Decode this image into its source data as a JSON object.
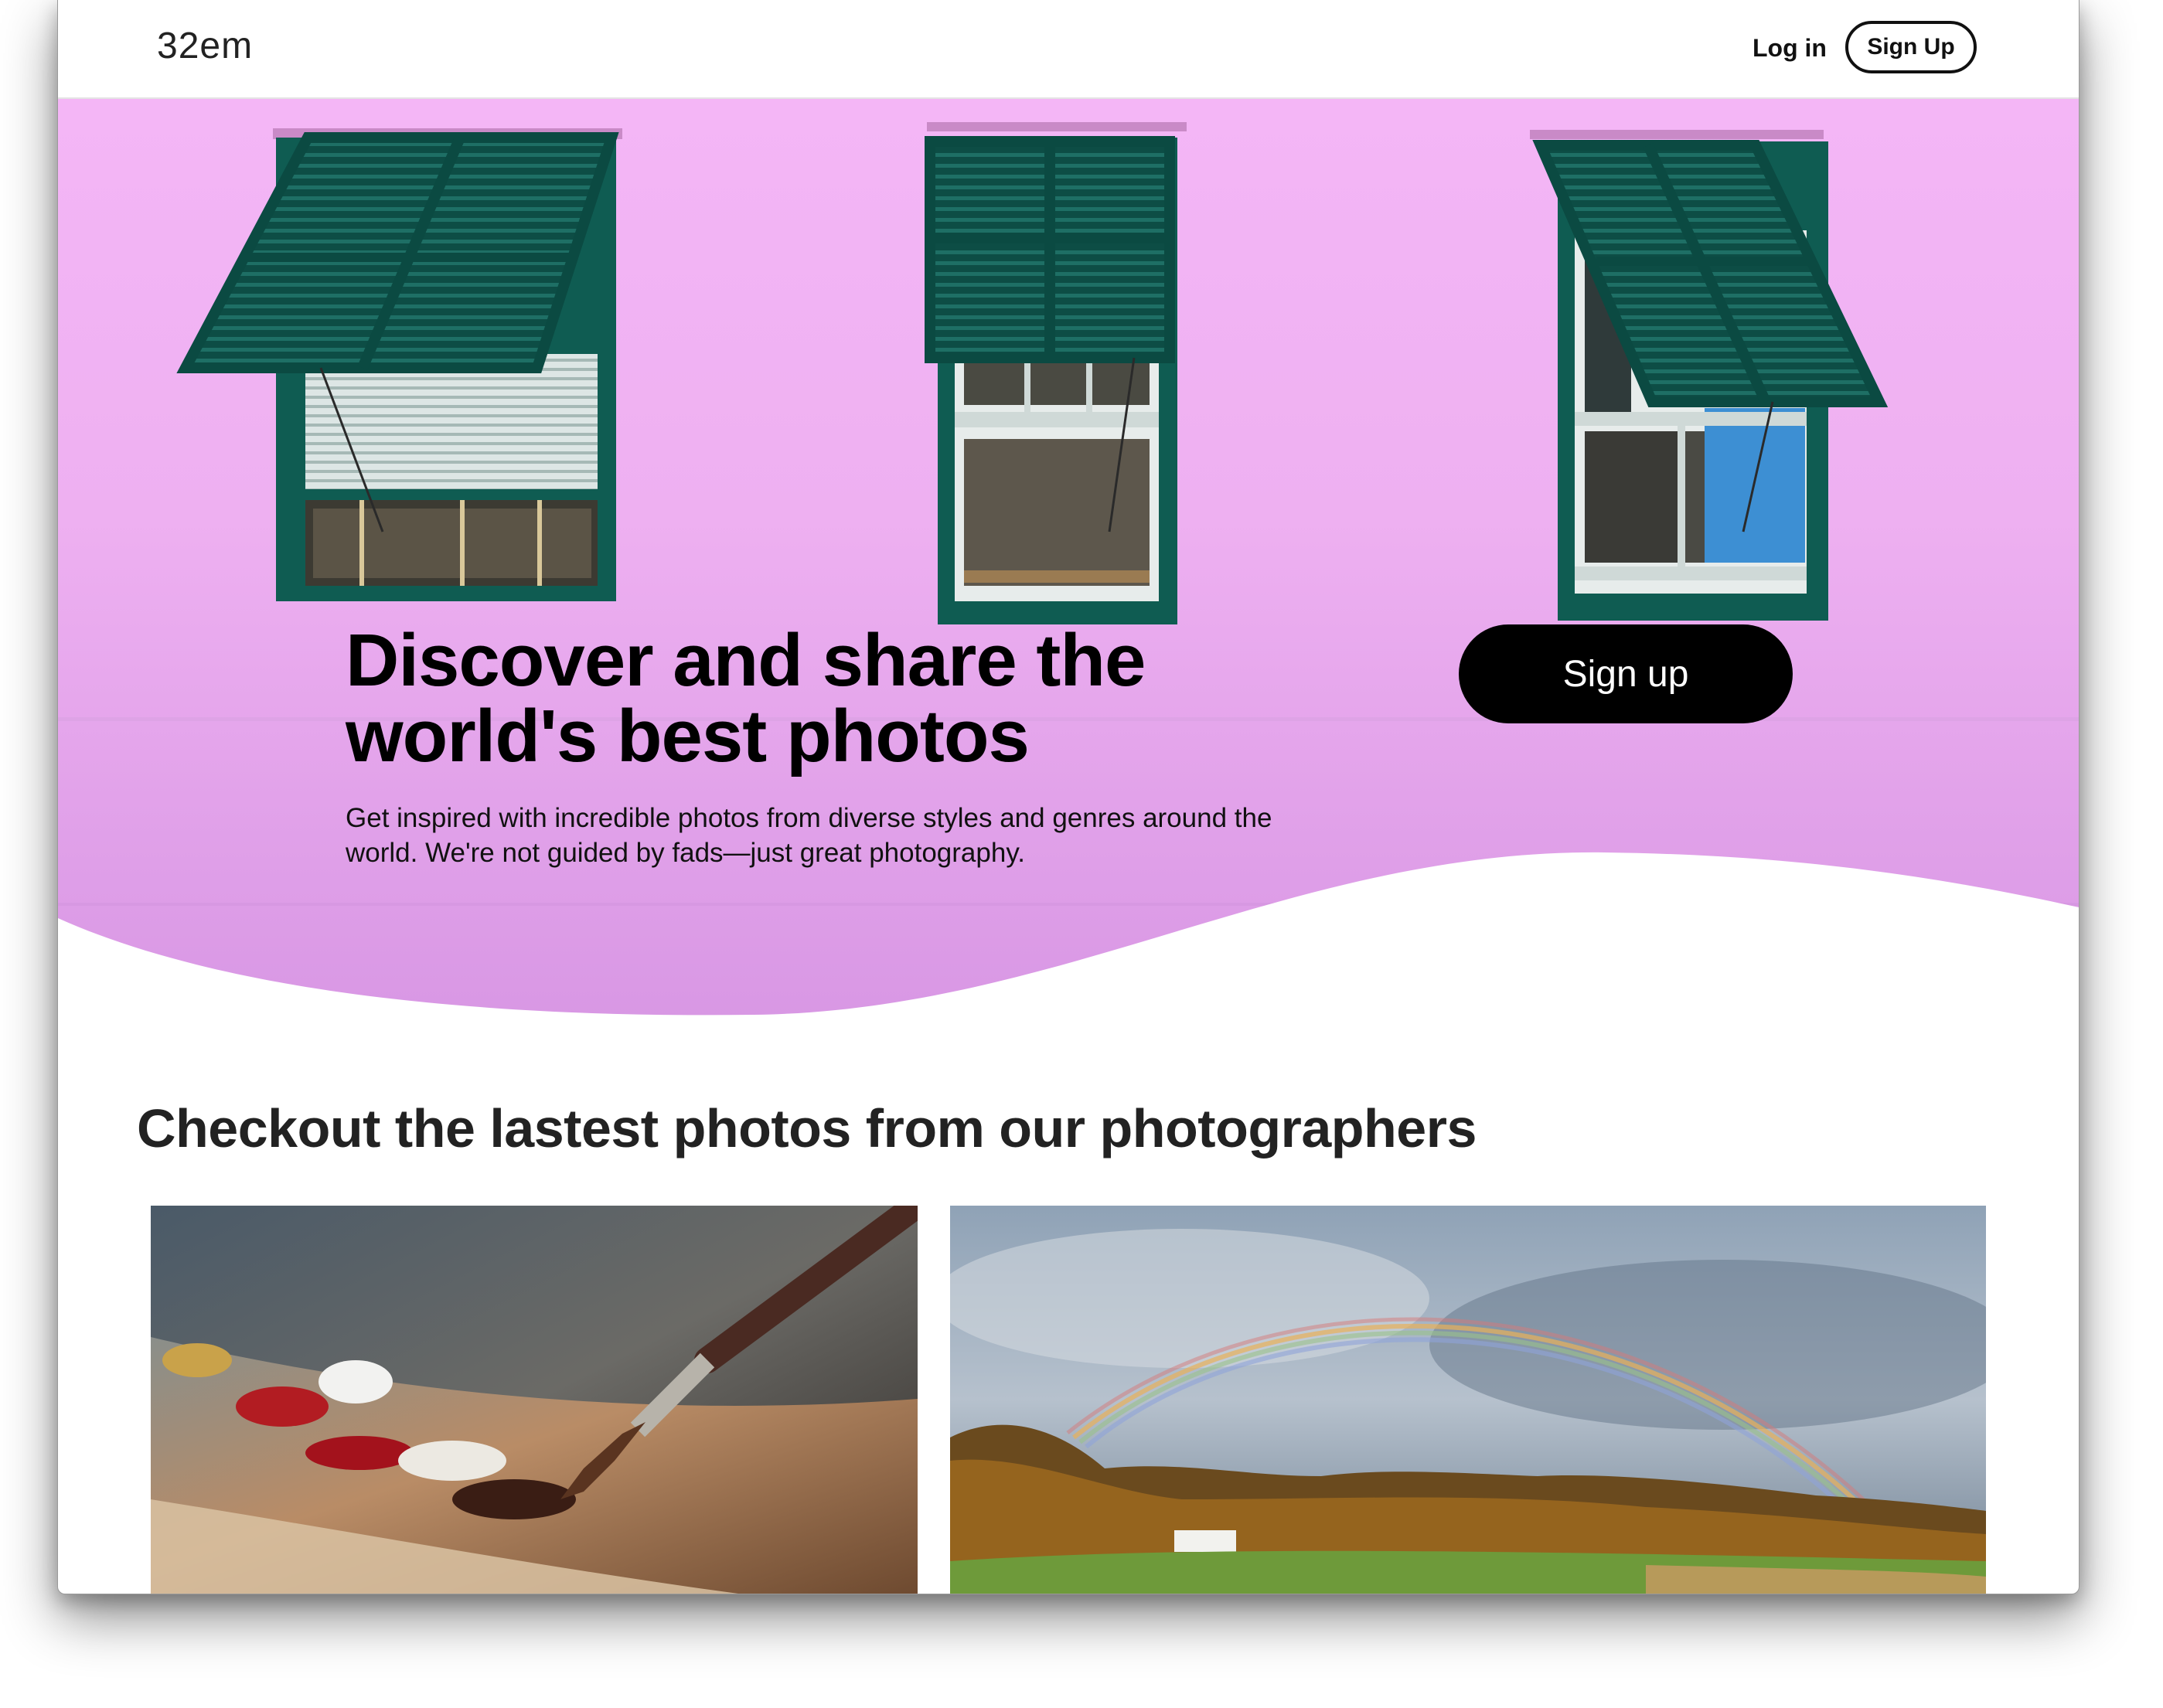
{
  "nav": {
    "brand": "32em",
    "login_label": "Log in",
    "signup_label": "Sign Up"
  },
  "hero": {
    "title_line1": "Discover and share the",
    "title_line2": "world's best photos",
    "subtitle_line1": "Get inspired with incredible photos from diverse styles and genres around the",
    "subtitle_line2": "world. We're not guided by fads—just great photography.",
    "cta_label": "Sign up"
  },
  "latest": {
    "title": "Checkout the lastest photos from our photographers"
  },
  "colors": {
    "hero_pink": "#ecaaf0",
    "shutter_green": "#0f5c52",
    "cta_black": "#000000"
  }
}
